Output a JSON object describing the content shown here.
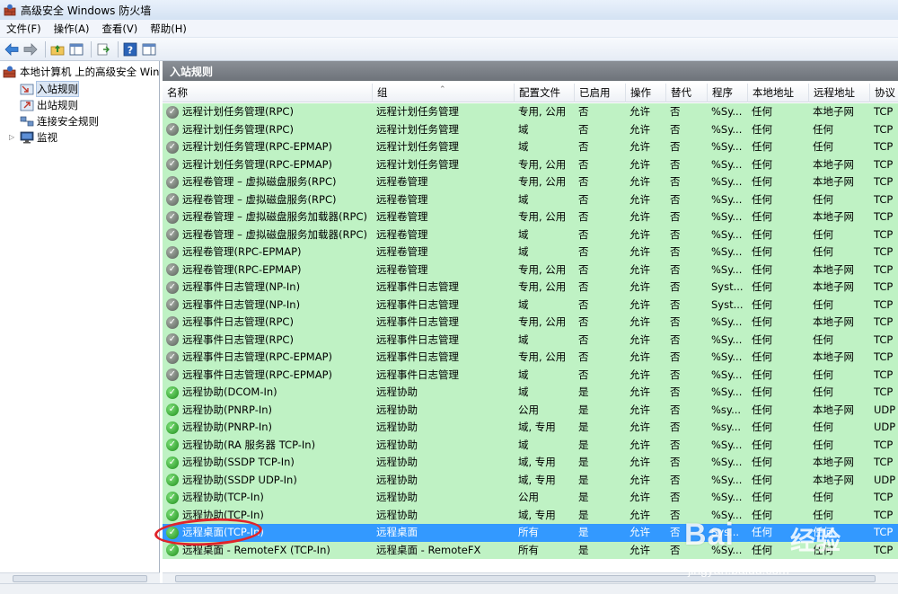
{
  "window": {
    "title": "高级安全 Windows 防火墙"
  },
  "menu": [
    "文件(F)",
    "操作(A)",
    "查看(V)",
    "帮助(H)"
  ],
  "tree": {
    "root": "本地计算机 上的高级安全 Windo",
    "items": [
      "入站规则",
      "出站规则",
      "连接安全规则",
      "监视"
    ]
  },
  "content": {
    "header": "入站规则",
    "columns": [
      "名称",
      "组",
      "配置文件",
      "已启用",
      "操作",
      "替代",
      "程序",
      "本地地址",
      "远程地址",
      "协议"
    ],
    "rows": [
      {
        "enabled": false,
        "cells": [
          "远程计划任务管理(RPC)",
          "远程计划任务管理",
          "专用, 公用",
          "否",
          "允许",
          "否",
          "%Sy...",
          "任何",
          "本地子网",
          "TCP"
        ]
      },
      {
        "enabled": false,
        "cells": [
          "远程计划任务管理(RPC)",
          "远程计划任务管理",
          "域",
          "否",
          "允许",
          "否",
          "%Sy...",
          "任何",
          "任何",
          "TCP"
        ]
      },
      {
        "enabled": false,
        "cells": [
          "远程计划任务管理(RPC-EPMAP)",
          "远程计划任务管理",
          "域",
          "否",
          "允许",
          "否",
          "%Sy...",
          "任何",
          "任何",
          "TCP"
        ]
      },
      {
        "enabled": false,
        "cells": [
          "远程计划任务管理(RPC-EPMAP)",
          "远程计划任务管理",
          "专用, 公用",
          "否",
          "允许",
          "否",
          "%Sy...",
          "任何",
          "本地子网",
          "TCP"
        ]
      },
      {
        "enabled": false,
        "cells": [
          "远程卷管理 – 虚拟磁盘服务(RPC)",
          "远程卷管理",
          "专用, 公用",
          "否",
          "允许",
          "否",
          "%Sy...",
          "任何",
          "本地子网",
          "TCP"
        ]
      },
      {
        "enabled": false,
        "cells": [
          "远程卷管理 – 虚拟磁盘服务(RPC)",
          "远程卷管理",
          "域",
          "否",
          "允许",
          "否",
          "%Sy...",
          "任何",
          "任何",
          "TCP"
        ]
      },
      {
        "enabled": false,
        "cells": [
          "远程卷管理 – 虚拟磁盘服务加载器(RPC)",
          "远程卷管理",
          "专用, 公用",
          "否",
          "允许",
          "否",
          "%Sy...",
          "任何",
          "本地子网",
          "TCP"
        ]
      },
      {
        "enabled": false,
        "cells": [
          "远程卷管理 – 虚拟磁盘服务加载器(RPC)",
          "远程卷管理",
          "域",
          "否",
          "允许",
          "否",
          "%Sy...",
          "任何",
          "任何",
          "TCP"
        ]
      },
      {
        "enabled": false,
        "cells": [
          "远程卷管理(RPC-EPMAP)",
          "远程卷管理",
          "域",
          "否",
          "允许",
          "否",
          "%Sy...",
          "任何",
          "任何",
          "TCP"
        ]
      },
      {
        "enabled": false,
        "cells": [
          "远程卷管理(RPC-EPMAP)",
          "远程卷管理",
          "专用, 公用",
          "否",
          "允许",
          "否",
          "%Sy...",
          "任何",
          "本地子网",
          "TCP"
        ]
      },
      {
        "enabled": false,
        "cells": [
          "远程事件日志管理(NP-In)",
          "远程事件日志管理",
          "专用, 公用",
          "否",
          "允许",
          "否",
          "Syst...",
          "任何",
          "本地子网",
          "TCP"
        ]
      },
      {
        "enabled": false,
        "cells": [
          "远程事件日志管理(NP-In)",
          "远程事件日志管理",
          "域",
          "否",
          "允许",
          "否",
          "Syst...",
          "任何",
          "任何",
          "TCP"
        ]
      },
      {
        "enabled": false,
        "cells": [
          "远程事件日志管理(RPC)",
          "远程事件日志管理",
          "专用, 公用",
          "否",
          "允许",
          "否",
          "%Sy...",
          "任何",
          "本地子网",
          "TCP"
        ]
      },
      {
        "enabled": false,
        "cells": [
          "远程事件日志管理(RPC)",
          "远程事件日志管理",
          "域",
          "否",
          "允许",
          "否",
          "%Sy...",
          "任何",
          "任何",
          "TCP"
        ]
      },
      {
        "enabled": false,
        "cells": [
          "远程事件日志管理(RPC-EPMAP)",
          "远程事件日志管理",
          "专用, 公用",
          "否",
          "允许",
          "否",
          "%Sy...",
          "任何",
          "本地子网",
          "TCP"
        ]
      },
      {
        "enabled": false,
        "cells": [
          "远程事件日志管理(RPC-EPMAP)",
          "远程事件日志管理",
          "域",
          "否",
          "允许",
          "否",
          "%Sy...",
          "任何",
          "任何",
          "TCP"
        ]
      },
      {
        "enabled": true,
        "cells": [
          "远程协助(DCOM-In)",
          "远程协助",
          "域",
          "是",
          "允许",
          "否",
          "%Sy...",
          "任何",
          "任何",
          "TCP"
        ]
      },
      {
        "enabled": true,
        "cells": [
          "远程协助(PNRP-In)",
          "远程协助",
          "公用",
          "是",
          "允许",
          "否",
          "%sy...",
          "任何",
          "本地子网",
          "UDP"
        ]
      },
      {
        "enabled": true,
        "cells": [
          "远程协助(PNRP-In)",
          "远程协助",
          "域, 专用",
          "是",
          "允许",
          "否",
          "%sy...",
          "任何",
          "任何",
          "UDP"
        ]
      },
      {
        "enabled": true,
        "cells": [
          "远程协助(RA 服务器 TCP-In)",
          "远程协助",
          "域",
          "是",
          "允许",
          "否",
          "%Sy...",
          "任何",
          "任何",
          "TCP"
        ]
      },
      {
        "enabled": true,
        "cells": [
          "远程协助(SSDP TCP-In)",
          "远程协助",
          "域, 专用",
          "是",
          "允许",
          "否",
          "%Sy...",
          "任何",
          "本地子网",
          "TCP"
        ]
      },
      {
        "enabled": true,
        "cells": [
          "远程协助(SSDP UDP-In)",
          "远程协助",
          "域, 专用",
          "是",
          "允许",
          "否",
          "%Sy...",
          "任何",
          "本地子网",
          "UDP"
        ]
      },
      {
        "enabled": true,
        "cells": [
          "远程协助(TCP-In)",
          "远程协助",
          "公用",
          "是",
          "允许",
          "否",
          "%Sy...",
          "任何",
          "任何",
          "TCP"
        ]
      },
      {
        "enabled": true,
        "cells": [
          "远程协助(TCP-In)",
          "远程协助",
          "域, 专用",
          "是",
          "允许",
          "否",
          "%Sy...",
          "任何",
          "任何",
          "TCP"
        ]
      },
      {
        "enabled": true,
        "selected": true,
        "cells": [
          "远程桌面(TCP-In)",
          "远程桌面",
          "所有",
          "是",
          "允许",
          "否",
          "Sys...",
          "任何",
          "任何",
          "TCP"
        ]
      },
      {
        "enabled": true,
        "cells": [
          "远程桌面 - RemoteFX (TCP-In)",
          "远程桌面 - RemoteFX",
          "所有",
          "是",
          "允许",
          "否",
          "%Sy...",
          "任何",
          "任何",
          "TCP"
        ]
      }
    ]
  },
  "watermark": {
    "logo": "Bai",
    "cn": "经验",
    "url": "jingyan.baidu.com"
  },
  "colors": {
    "row_bg": "#bff2c4",
    "selected_bg": "#3399ff",
    "highlight_ring": "#e0242a"
  }
}
